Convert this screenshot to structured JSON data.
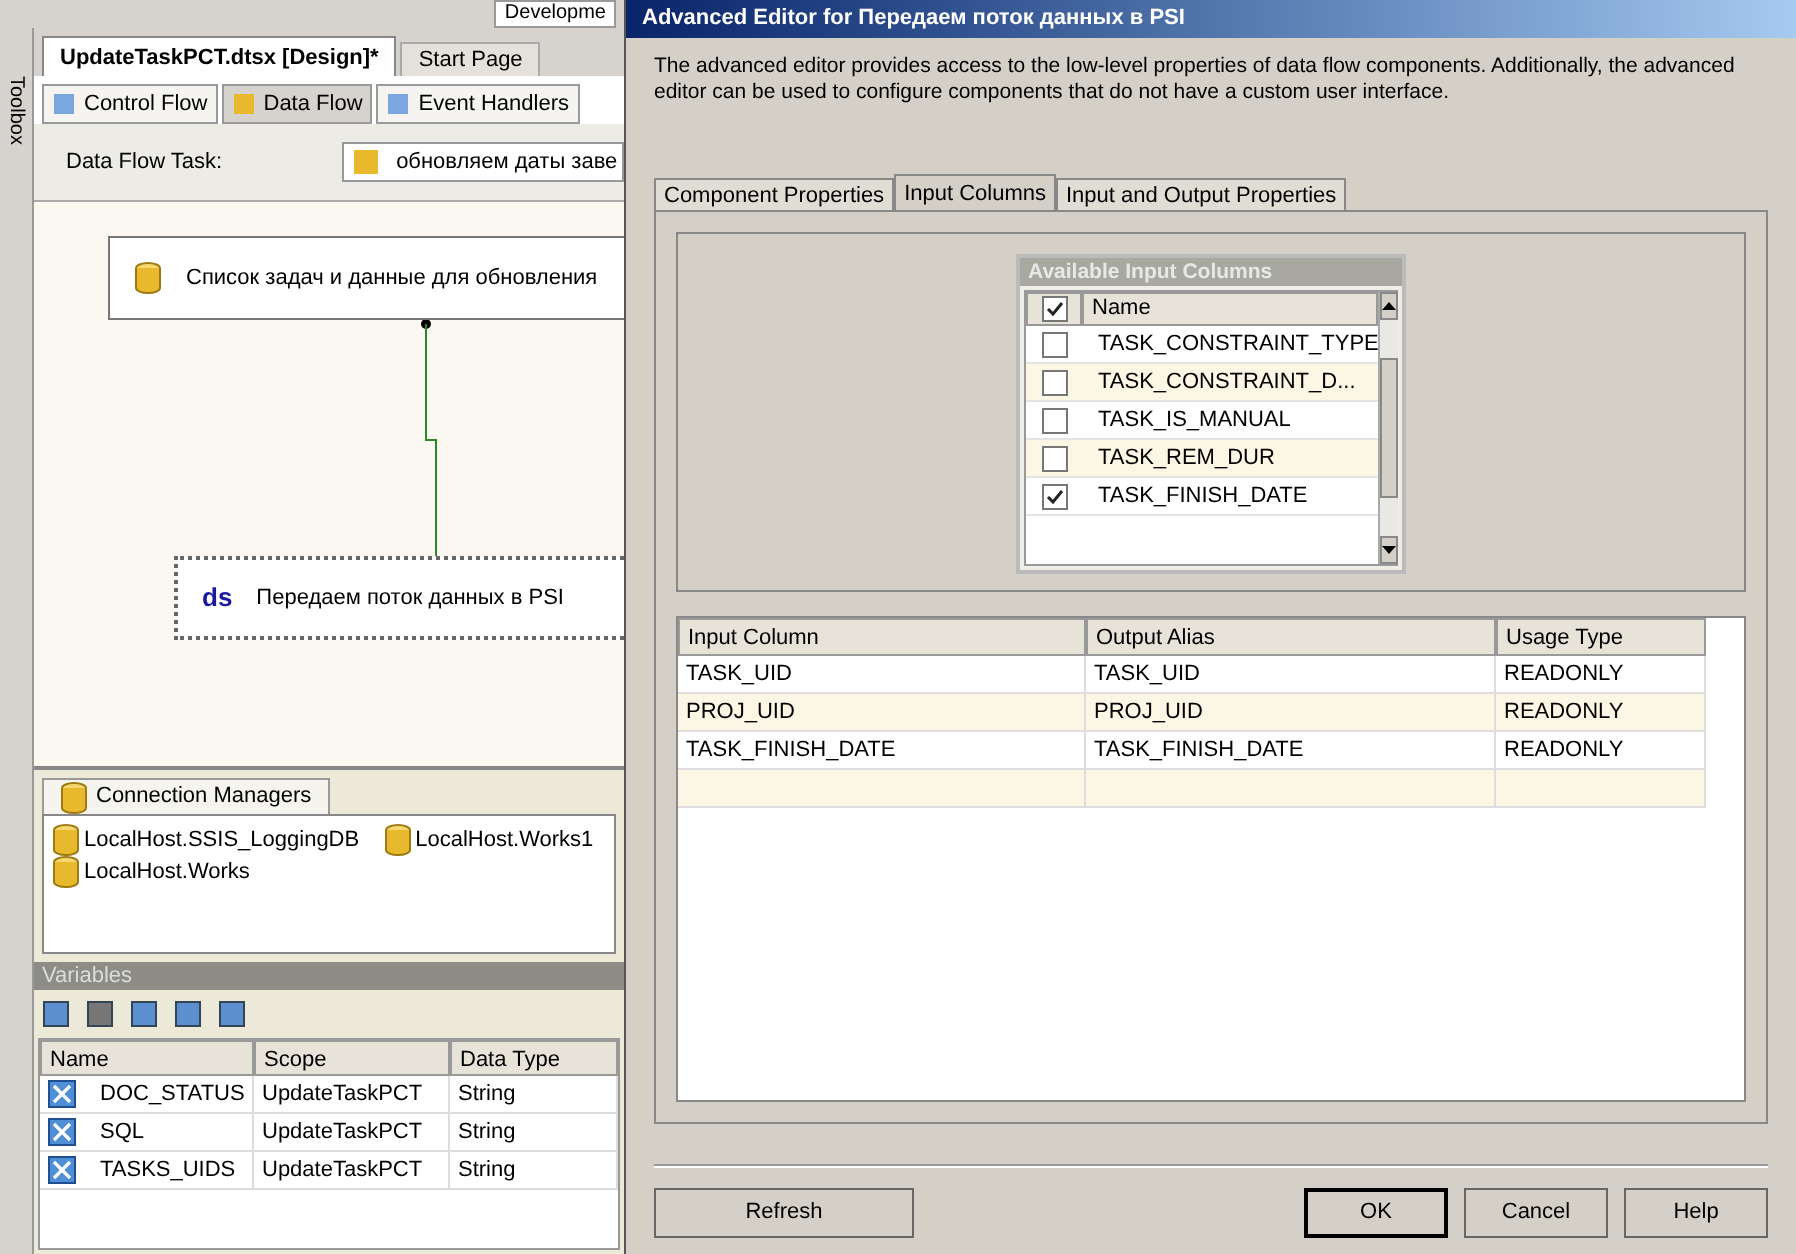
{
  "toolbar": {
    "config": "Developme"
  },
  "toolbox": {
    "label": "Toolbox"
  },
  "doc_tabs": [
    {
      "label": "UpdateTaskPCT.dtsx [Design]*",
      "selected": true
    },
    {
      "label": "Start Page",
      "selected": false
    }
  ],
  "designer_tabs": [
    {
      "label": "Control Flow",
      "selected": false
    },
    {
      "label": "Data Flow",
      "selected": true
    },
    {
      "label": "Event Handlers",
      "selected": false
    }
  ],
  "task_selector": {
    "label": "Data Flow Task:",
    "value": "обновляем даты заве"
  },
  "canvas": {
    "nodes": [
      {
        "kind": "source",
        "label": "Список задач и данные для обновления",
        "selected": false
      },
      {
        "kind": "destination",
        "badge": "ds",
        "label": "Передаем поток данных в PSI",
        "selected": true
      }
    ]
  },
  "connection_managers": {
    "tab": "Connection Managers",
    "items": [
      "LocalHost.SSIS_LoggingDB",
      "LocalHost.Works1",
      "LocalHost.Works"
    ]
  },
  "variables": {
    "title": "Variables",
    "columns": [
      "Name",
      "Scope",
      "Data Type"
    ],
    "rows": [
      [
        "DOC_STATUS",
        "UpdateTaskPCT",
        "String"
      ],
      [
        "SQL",
        "UpdateTaskPCT",
        "String"
      ],
      [
        "TASKS_UIDS",
        "UpdateTaskPCT",
        "String"
      ]
    ]
  },
  "dialog": {
    "title": "Advanced Editor for Передаем поток данных в PSI",
    "description": "The advanced editor provides access to the low-level properties of data flow components. Additionally, the advanced editor can be used to configure components that do not have a custom user interface.",
    "tabs": [
      {
        "label": "Component Properties",
        "selected": false
      },
      {
        "label": "Input Columns",
        "selected": true
      },
      {
        "label": "Input and Output Properties",
        "selected": false
      }
    ],
    "available_columns": {
      "title": "Available Input Columns",
      "header": "Name",
      "all_checked": true,
      "items": [
        {
          "name": "TASK_CONSTRAINT_TYPE",
          "checked": false
        },
        {
          "name": "TASK_CONSTRAINT_D...",
          "checked": false
        },
        {
          "name": "TASK_IS_MANUAL",
          "checked": false
        },
        {
          "name": "TASK_REM_DUR",
          "checked": false
        },
        {
          "name": "TASK_FINISH_DATE",
          "checked": true
        }
      ]
    },
    "mapping": {
      "columns": [
        "Input Column",
        "Output Alias",
        "Usage Type"
      ],
      "rows": [
        [
          "TASK_UID",
          "TASK_UID",
          "READONLY"
        ],
        [
          "PROJ_UID",
          "PROJ_UID",
          "READONLY"
        ],
        [
          "TASK_FINISH_DATE",
          "TASK_FINISH_DATE",
          "READONLY"
        ]
      ]
    },
    "buttons": [
      {
        "label": "Refresh",
        "kind": "left"
      },
      {
        "label": "OK",
        "kind": "default"
      },
      {
        "label": "Cancel",
        "kind": "right"
      },
      {
        "label": "Help",
        "kind": "right"
      }
    ]
  }
}
